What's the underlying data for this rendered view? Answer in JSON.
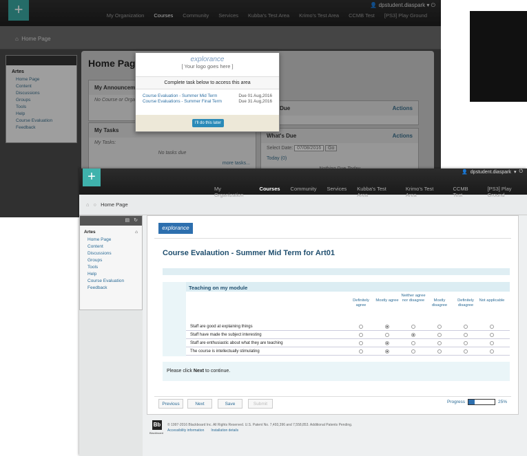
{
  "back": {
    "user": "dpstudent.diaspark",
    "nav": [
      "My Organization",
      "Courses",
      "Community",
      "Services",
      "Kubba's Test Area",
      "Krimo's Test Area",
      "CCMB Test",
      "[PS3] Play Ground"
    ],
    "breadcrumb": "Home Page",
    "course": "Artes",
    "menu": [
      "Home Page",
      "Content",
      "Discussions",
      "Groups",
      "Tools",
      "Help",
      "Course Evaluation",
      "Feedback"
    ],
    "page_title": "Home Page",
    "announcements_title": "My Announcements",
    "announcements_text": "No Course or Orga",
    "tasks_title": "My Tasks",
    "tasks_label": "My Tasks:",
    "tasks_empty": "No tasks due",
    "more_tasks": "more tasks...",
    "past_due": "Past Due",
    "whats_due": "What's Due",
    "actions": "Actions",
    "select_date_label": "Select Date:",
    "select_date_value": "07/08/2016",
    "go": "Go",
    "today": "Today (0)",
    "nothing_due": "Nothing Due Today",
    "popup": {
      "brand": "explorance",
      "tagline": "[ Your logo goes here ]",
      "instruction": "Complete task below to access this area",
      "tasks": [
        {
          "name": "Course Evaluation - Summer Mid Term",
          "due": "Due 01 Aug,2016"
        },
        {
          "name": "Course Evaluations - Summer Final Term",
          "due": "Due 31 Aug,2016"
        }
      ],
      "later_button": "I'll do this later"
    }
  },
  "front": {
    "user": "dpstudent.diaspark",
    "nav": [
      "My Organization",
      "Courses",
      "Community",
      "Services",
      "Kubba's Test Area",
      "Krimo's Test Area",
      "CCMB Test",
      "[PS3] Play Ground"
    ],
    "active_nav": "Courses",
    "breadcrumb": "Home Page",
    "course": "Artes",
    "menu": [
      "Home Page",
      "Content",
      "Discussions",
      "Groups",
      "Tools",
      "Help",
      "Course Evaluation",
      "Feedback"
    ],
    "brand": "explorance",
    "survey_title": "Course Evalaution - Summer Mid Term for Art01",
    "section_title": "Teaching on my module",
    "scale": [
      "Definitely agree",
      "Mostly agree",
      "Neither agree nor disagree",
      "Mostly disagree",
      "Definitely disagree",
      "Not applicable"
    ],
    "questions": [
      {
        "text": "Staff are good at explaining things",
        "selected": 1
      },
      {
        "text": "Staff have made the subject interesting",
        "selected": 2
      },
      {
        "text": "Staff are enthusiastic about what they are teaching",
        "selected": 1
      },
      {
        "text": "The course is intellectually stimulating",
        "selected": 1
      }
    ],
    "next_msg_pre": "Please click ",
    "next_msg_bold": "Next",
    "next_msg_post": " to continue.",
    "buttons": {
      "previous": "Previous",
      "next": "Next",
      "save": "Save",
      "submit": "Submit"
    },
    "progress_label": "Progress",
    "progress_value": 0.25,
    "progress_text": "25%",
    "footer_copyright": "© 1997-2016 Blackboard Inc. All Rights Reserved. U.S. Patent No. 7,493,396 and 7,558,853. Additional Patents Pending.",
    "footer_links": [
      "Accessibility information",
      "Installation details"
    ],
    "bb_logo": "Bb",
    "bb_label": "Blackboard"
  }
}
